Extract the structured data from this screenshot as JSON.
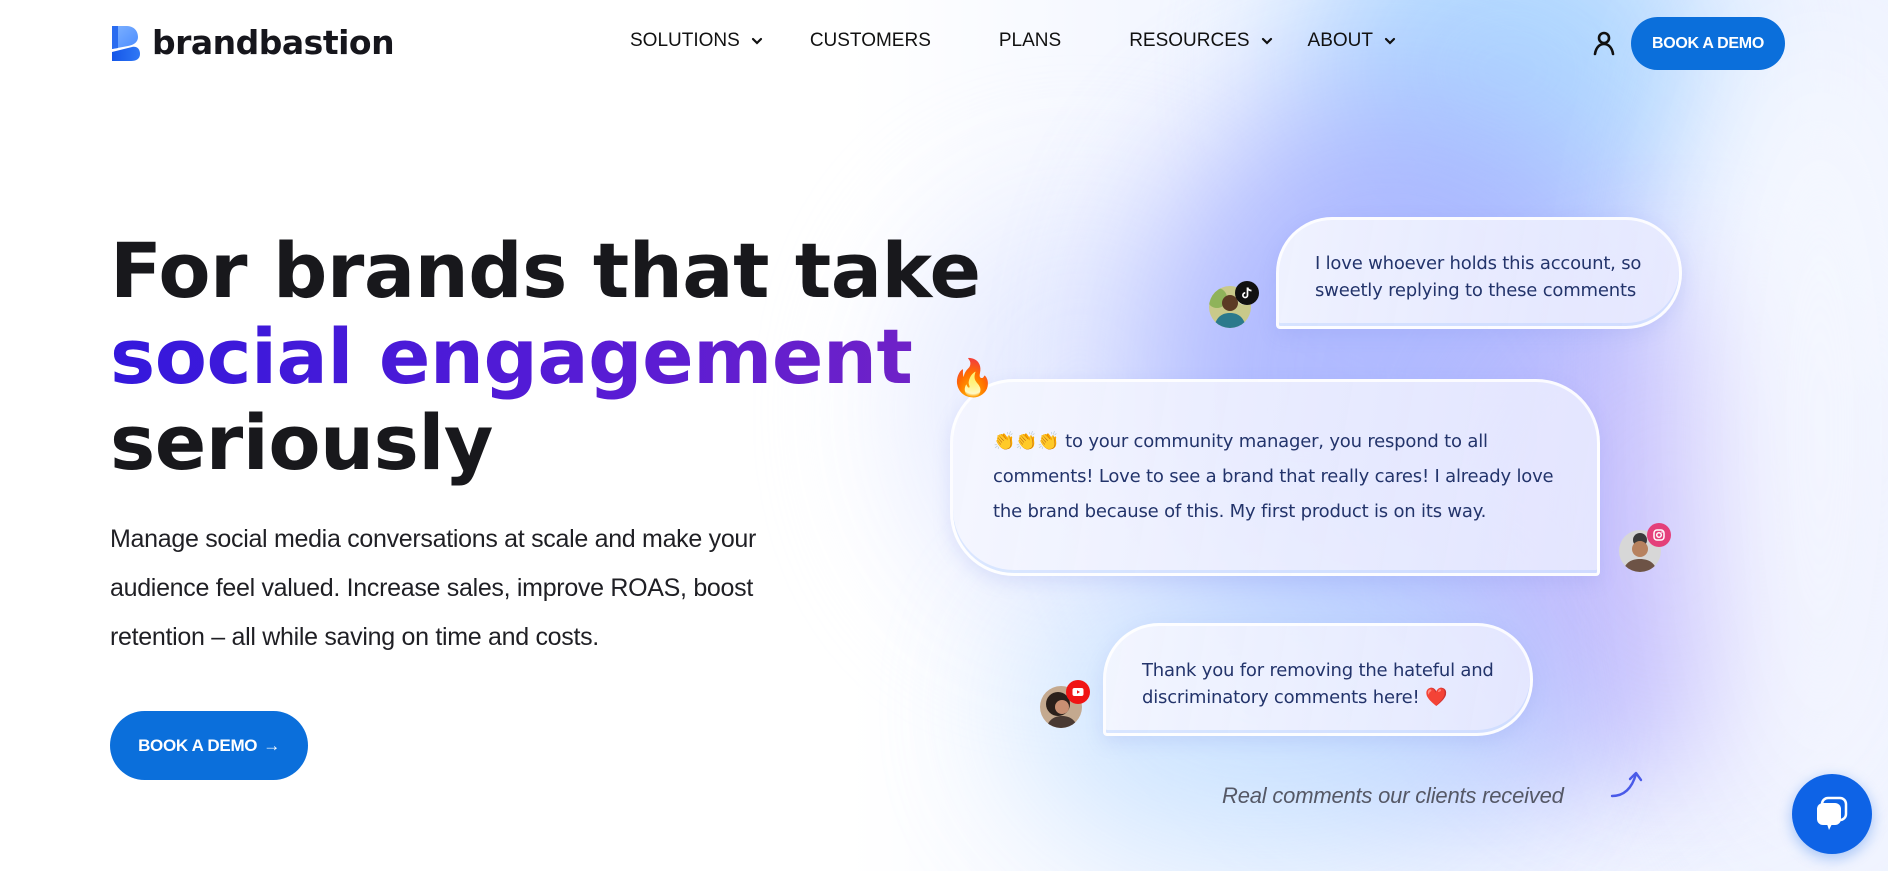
{
  "header": {
    "logo_text": "brandbastion",
    "nav": [
      {
        "label": "SOLUTIONS",
        "has_dropdown": true
      },
      {
        "label": "CUSTOMERS",
        "has_dropdown": false
      },
      {
        "label": "PLANS",
        "has_dropdown": false
      },
      {
        "label": "RESOURCES",
        "has_dropdown": true
      },
      {
        "label": "ABOUT",
        "has_dropdown": true
      }
    ],
    "account_icon": "user-icon",
    "cta_label": "BOOK A DEMO"
  },
  "hero": {
    "title_line1": "For brands that take",
    "title_accent": "social engagement",
    "title_line3": "seriously",
    "subtitle": "Manage social media conversations at scale and make your audience feel valued. Increase sales, improve ROAS, boost retention – all while saving on time and costs.",
    "cta_label": "BOOK A DEMO",
    "cta_arrow": "→"
  },
  "comments": [
    {
      "platform": "tiktok",
      "text": "I love whoever holds this account, so sweetly replying to these comments"
    },
    {
      "platform": "instagram",
      "emoji_prefix": "👏👏👏",
      "text": " to your community manager, you respond to all comments! Love to see a brand that really cares! I already love the brand because of this. My first product is on its way.",
      "decoration": "🔥"
    },
    {
      "platform": "youtube",
      "text": "Thank you for removing the hateful and discriminatory comments here! ",
      "emoji_suffix": "❤️"
    }
  ],
  "caption": "Real comments our clients received",
  "chat_widget": {
    "icon": "chat-bubble-icon"
  },
  "colors": {
    "primary": "#0b6fdb",
    "accent_gradient_start": "#3418dc",
    "accent_gradient_end": "#7423c4",
    "comment_text": "#23346b",
    "tiktok": "#111111",
    "instagram": "#e4407a",
    "youtube": "#f01414",
    "chat_launcher": "#0e63e6"
  }
}
